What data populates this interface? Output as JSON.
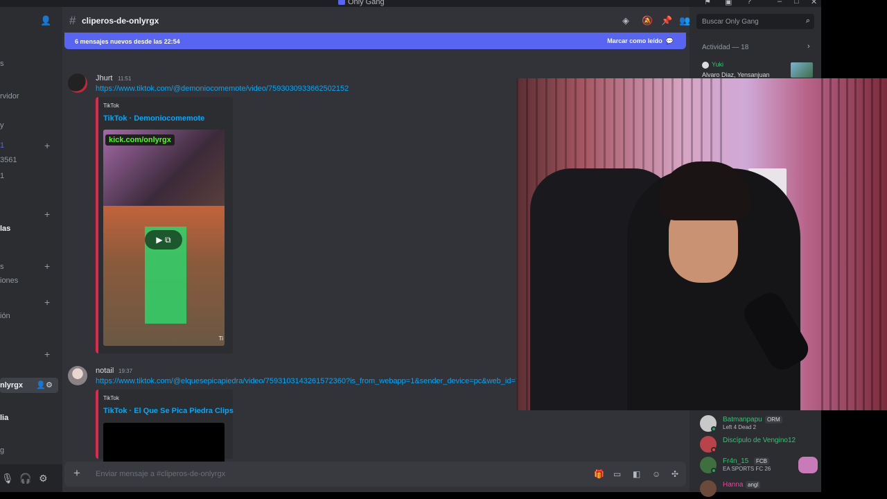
{
  "window": {
    "title": "Only Gang"
  },
  "sidebar": {
    "items": [
      {
        "label": "s"
      },
      {
        "label": "rvidor"
      },
      {
        "label": "y"
      },
      {
        "label": "1"
      },
      {
        "label": "3561"
      },
      {
        "label": "1"
      },
      {
        "label": "las"
      },
      {
        "label": "s"
      },
      {
        "label": "iones"
      },
      {
        "label": "ión"
      },
      {
        "label": "nlyrgx"
      },
      {
        "label": "lia"
      },
      {
        "label": "g"
      }
    ]
  },
  "channel": {
    "name": "cliperos-de-onlyrgx"
  },
  "new_messages_banner": {
    "text": "6 mensajes nuevos desde las 22:54",
    "action": "Marcar como leído"
  },
  "messages": [
    {
      "author": "Jhurt",
      "time": "11:51",
      "link": "https://www.tiktok.com/@demoniocomemote/video/7593030933662502152",
      "embed": {
        "provider": "TikTok",
        "title": "TikTok · Demoniocomemote",
        "overlay_text": "kick.com/onlyrgx",
        "corner_text": "Ti"
      }
    },
    {
      "author": "notail",
      "time": "19:37",
      "link": "https://www.tiktok.com/@elquesepicapiedra/video/7593103143261572360?is_from_webapp=1&sender_device=pc&web_id=7507",
      "embed": {
        "provider": "TikTok",
        "title": "TikTok · El Que Se Pica Piedra Clips"
      }
    }
  ],
  "composer": {
    "placeholder": "Enviar mensaje a #cliperos-de-onlyrgx"
  },
  "members_panel": {
    "search_placeholder": "Buscar Only Gang",
    "activity_header": "Actividad — 18",
    "activity_card": {
      "name": "Yuki",
      "subtitle": "Alvaro Diaz, Yensanjuan"
    },
    "members": [
      {
        "name": "Batmanpapu",
        "badge": "ORM",
        "status": "Left 4 Dead 2",
        "color": "#2dc770"
      },
      {
        "name": "Discípulo de Vengino12",
        "badge": "",
        "status": "",
        "color": "#2dc770"
      },
      {
        "name": "Fr4n_15",
        "badge": "FCB",
        "status": "EA SPORTS FC 26",
        "color": "#2dc770"
      },
      {
        "name": "Hanna",
        "badge": "angl",
        "status": "",
        "color": "#2dc770"
      }
    ]
  },
  "icons": {
    "header": [
      "threads-icon",
      "mute-icon",
      "pin-icon",
      "members-icon"
    ],
    "composer": [
      "gift-icon",
      "gif-icon",
      "sticker-icon",
      "emoji-icon",
      "apps-icon"
    ]
  }
}
